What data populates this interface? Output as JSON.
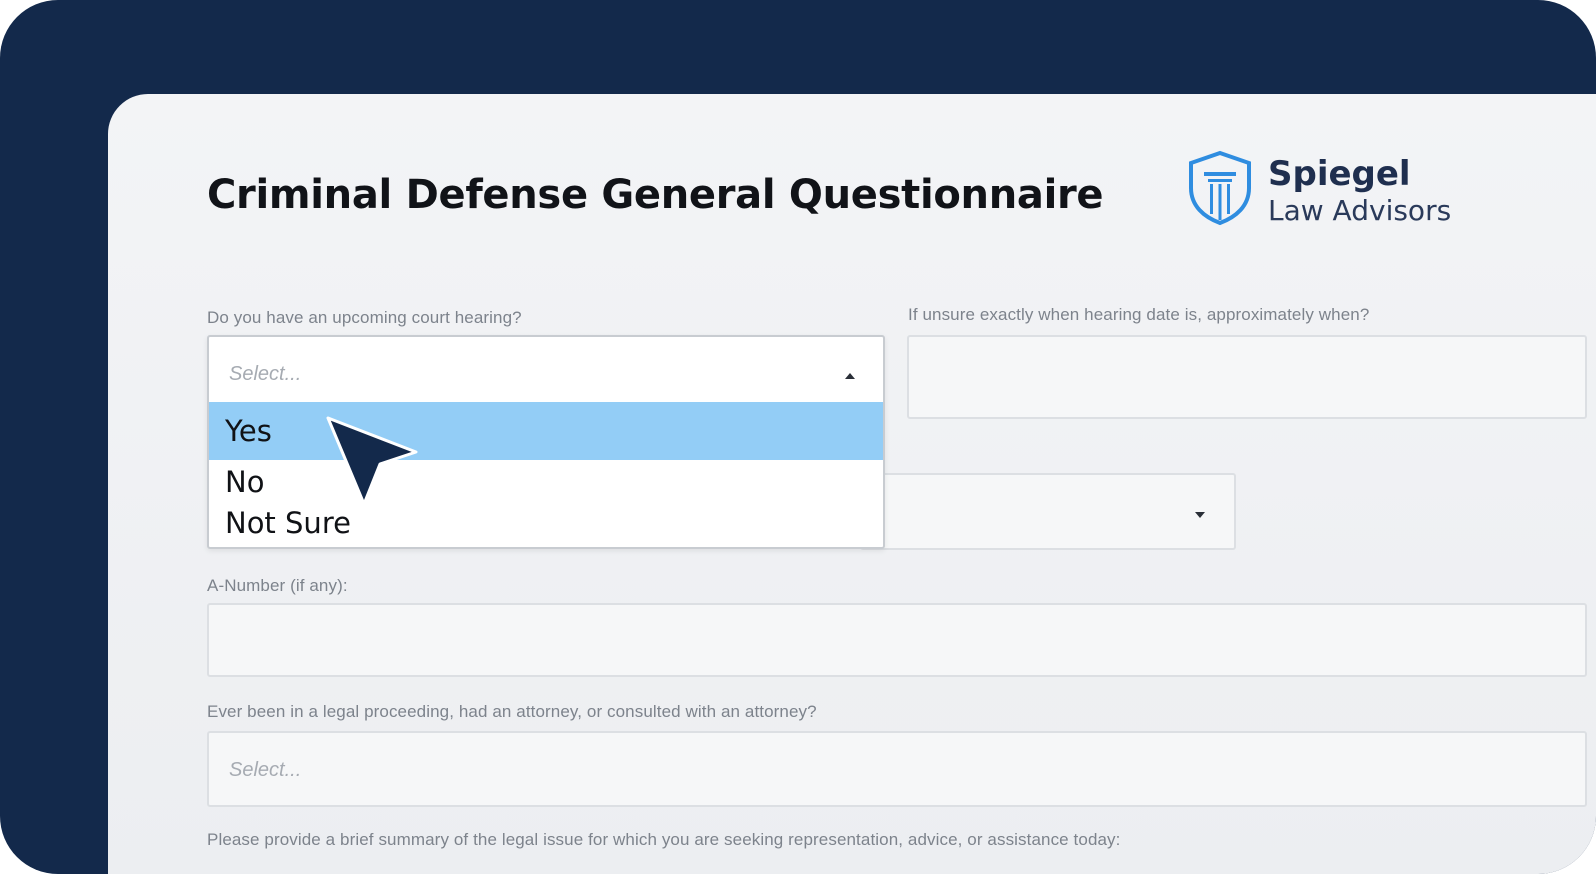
{
  "page": {
    "title": "Criminal Defense General Questionnaire"
  },
  "brand": {
    "name": "Spiegel",
    "tagline": "Law Advisors",
    "icon": "shield-column-icon",
    "color": "#2f8de0"
  },
  "form": {
    "court_hearing": {
      "label": "Do you have an upcoming court hearing?",
      "placeholder": "Select...",
      "options": [
        "Yes",
        "No",
        "Not Sure"
      ],
      "highlighted": "Yes"
    },
    "hearing_approx": {
      "label": "If unsure exactly when hearing date is, approximately when?",
      "value": ""
    },
    "a_number": {
      "label": "A-Number (if any):",
      "value": ""
    },
    "legal_history": {
      "label": "Ever been in a legal proceeding, had an attorney, or consulted with an attorney?",
      "placeholder": "Select..."
    },
    "summary": {
      "label": "Please provide a brief summary of the legal issue for which you are seeking representation, advice, or assistance today:"
    }
  },
  "colors": {
    "frame": "#13294b",
    "highlight": "#93cdf6",
    "cursor": "#13294b"
  }
}
